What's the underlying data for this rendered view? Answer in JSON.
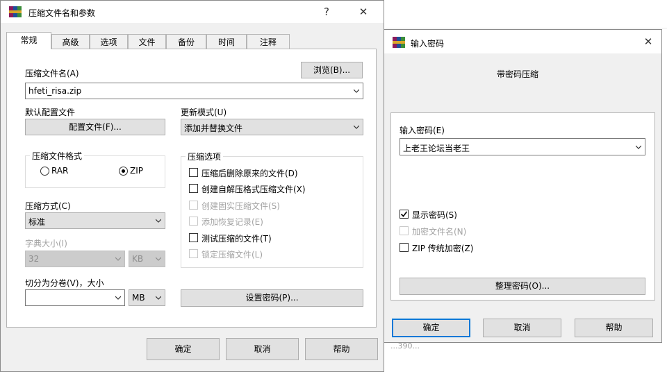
{
  "background": {
    "text": "...390..."
  },
  "main": {
    "title": "压缩文件名和参数",
    "help_btn": "?",
    "close_btn": "✕",
    "tabs": [
      "常规",
      "高级",
      "选项",
      "文件",
      "备份",
      "时间",
      "注释"
    ],
    "archive_name_label": "压缩文件名(A)",
    "browse_label": "浏览(B)...",
    "archive_name_value": "hfeti_risa.zip",
    "default_profile_label": "默认配置文件",
    "profile_button": "配置文件(F)...",
    "update_mode_label": "更新模式(U)",
    "update_mode_value": "添加并替换文件",
    "format_group_label": "压缩文件格式",
    "format_options": [
      {
        "label": "RAR",
        "checked": false
      },
      {
        "label": "ZIP",
        "checked": true
      }
    ],
    "options_group_label": "压缩选项",
    "options": [
      {
        "label": "压缩后删除原来的文件(D)",
        "checked": false,
        "enabled": true
      },
      {
        "label": "创建自解压格式压缩文件(X)",
        "checked": false,
        "enabled": true
      },
      {
        "label": "创建固实压缩文件(S)",
        "checked": false,
        "enabled": false
      },
      {
        "label": "添加恢复记录(E)",
        "checked": false,
        "enabled": false
      },
      {
        "label": "测试压缩的文件(T)",
        "checked": false,
        "enabled": true
      },
      {
        "label": "锁定压缩文件(L)",
        "checked": false,
        "enabled": false
      }
    ],
    "method_label": "压缩方式(C)",
    "method_value": "标准",
    "dict_label": "字典大小(I)",
    "dict_value": "32",
    "dict_unit": "KB",
    "split_label": "切分为分卷(V)，大小",
    "split_value": "",
    "split_unit": "MB",
    "set_password_button": "设置密码(P)...",
    "ok": "确定",
    "cancel": "取消",
    "help": "帮助"
  },
  "password": {
    "title": "输入密码",
    "close_btn": "✕",
    "heading": "带密码压缩",
    "input_label": "输入密码(E)",
    "input_value": "上老王论坛当老王",
    "options": [
      {
        "label": "显示密码(S)",
        "checked": true,
        "enabled": true
      },
      {
        "label": "加密文件名(N)",
        "checked": false,
        "enabled": false
      },
      {
        "label": "ZIP 传统加密(Z)",
        "checked": false,
        "enabled": true
      }
    ],
    "organize_button": "整理密码(O)...",
    "ok": "确定",
    "cancel": "取消",
    "help": "帮助"
  }
}
